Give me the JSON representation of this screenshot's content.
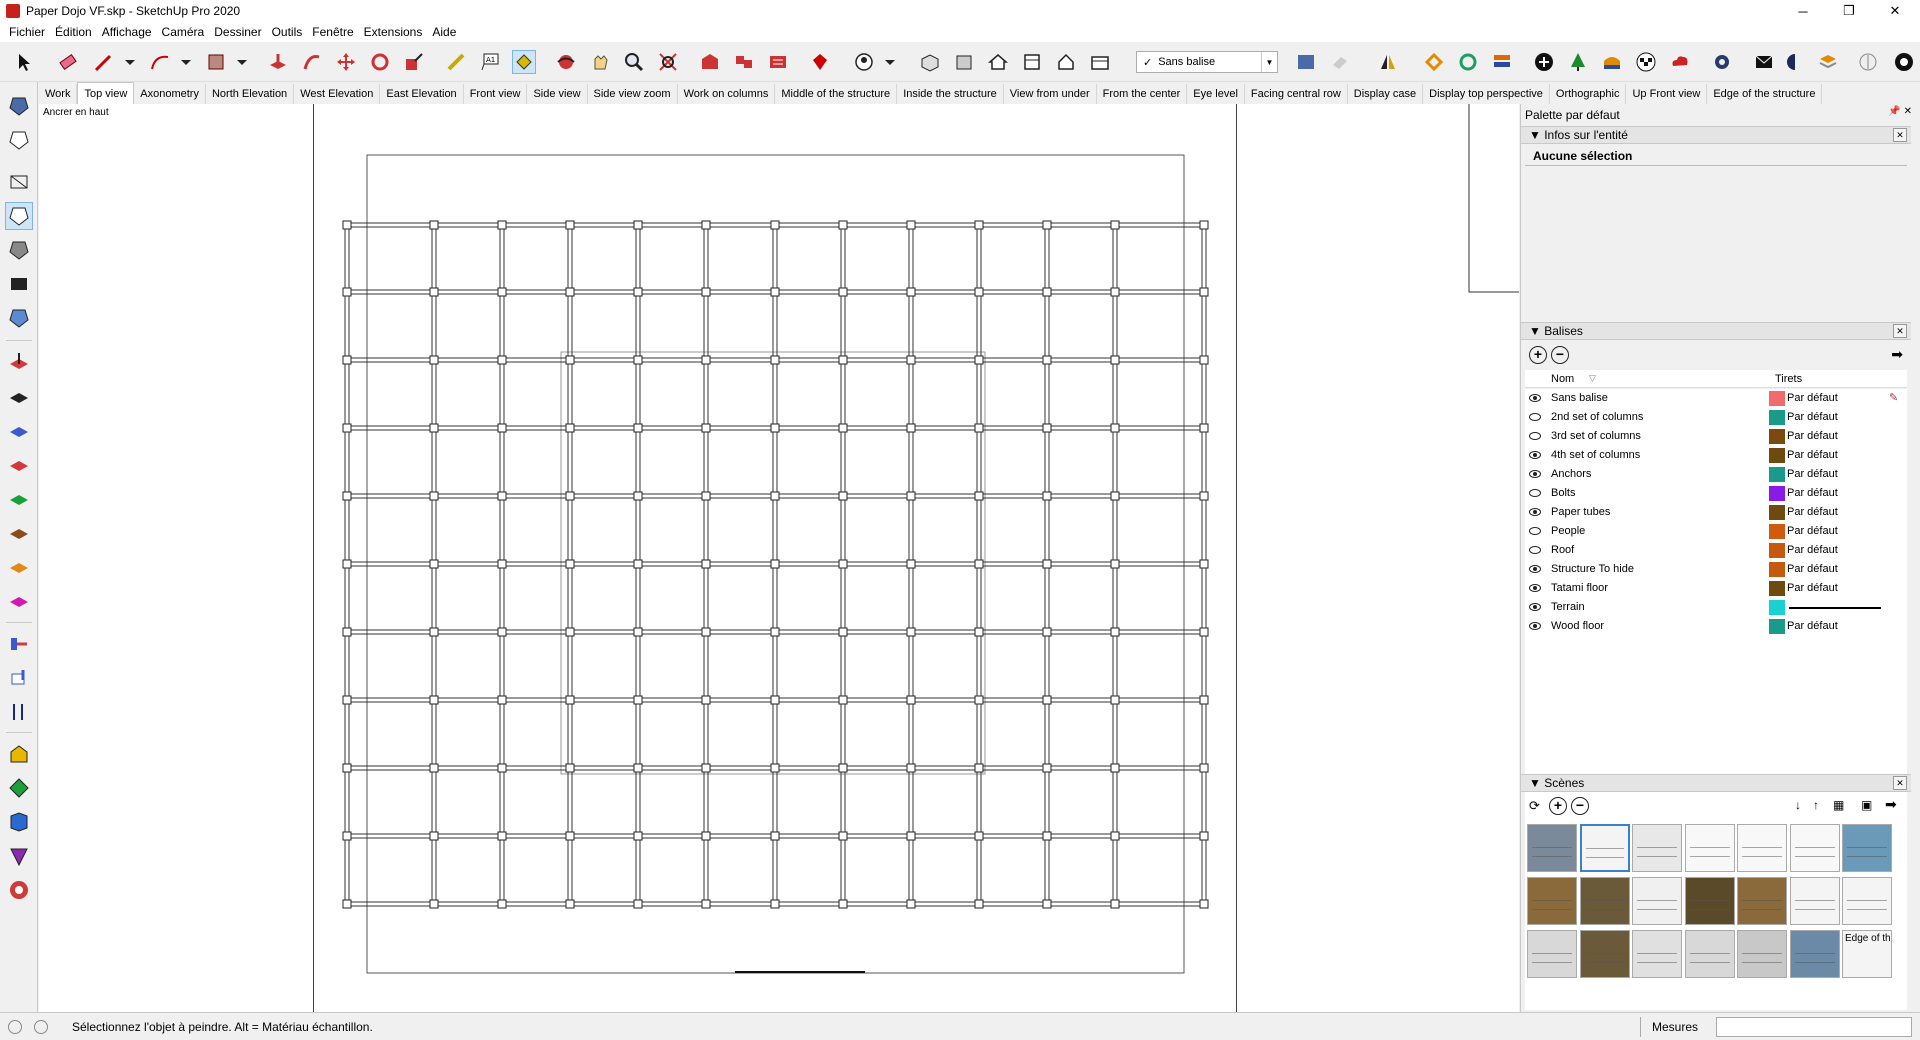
{
  "window": {
    "title": "Paper Dojo VF.skp - SketchUp Pro 2020",
    "min": "─",
    "max": "❐",
    "close": "✕"
  },
  "menu": [
    "Fichier",
    "Édition",
    "Affichage",
    "Caméra",
    "Dessiner",
    "Outils",
    "Fenêtre",
    "Extensions",
    "Aide"
  ],
  "toolbar": {
    "tag_selected": "Sans balise",
    "tag_check": "✓"
  },
  "scene_tabs": [
    "Work",
    "Top view",
    "Axonometry",
    "North Elevation",
    "West Elevation",
    "East Elevation",
    "Front view",
    "Side view",
    "Side view zoom",
    "Work on columns",
    "Middle of the structure",
    "Inside the structure",
    "View from under",
    "From the center",
    "Eye level",
    "Facing central row",
    "Display case",
    "Display top perspective",
    "Orthographic",
    "Up Front view",
    "Edge of the structure"
  ],
  "active_scene_tab": 1,
  "viewport": {
    "anchor_label": "Ancrer en haut"
  },
  "tray": {
    "title": "Palette par défaut",
    "entity_panel": {
      "title": "Infos sur l'entité",
      "content": "Aucune sélection"
    },
    "tags_panel": {
      "title": "Balises",
      "col_name": "Nom",
      "col_dashes": "Tirets",
      "rows": [
        {
          "name": "Sans balise",
          "visible": true,
          "color": "#f26b6b",
          "dashes": "Par défaut"
        },
        {
          "name": "2nd set of columns",
          "visible": false,
          "color": "#1a9a8a",
          "dashes": "Par défaut"
        },
        {
          "name": "3rd set of columns",
          "visible": false,
          "color": "#7a4a10",
          "dashes": "Par défaut"
        },
        {
          "name": "4th set of columns",
          "visible": true,
          "color": "#6e4a10",
          "dashes": "Par défaut"
        },
        {
          "name": "Anchors",
          "visible": true,
          "color": "#1a9a8a",
          "dashes": "Par défaut"
        },
        {
          "name": "Bolts",
          "visible": false,
          "color": "#8a1ae6",
          "dashes": "Par défaut"
        },
        {
          "name": "Paper tubes",
          "visible": true,
          "color": "#6e4a10",
          "dashes": "Par défaut"
        },
        {
          "name": "People",
          "visible": false,
          "color": "#d05a10",
          "dashes": "Par défaut"
        },
        {
          "name": "Roof",
          "visible": false,
          "color": "#c45a10",
          "dashes": "Par défaut"
        },
        {
          "name": "Structure To hide",
          "visible": true,
          "color": "#c45a10",
          "dashes": "Par défaut"
        },
        {
          "name": "Tatami floor",
          "visible": true,
          "color": "#6e4a10",
          "dashes": "Par défaut"
        },
        {
          "name": "Terrain",
          "visible": true,
          "color": "#1ad0d0",
          "dashes": ""
        },
        {
          "name": "Wood floor",
          "visible": true,
          "color": "#1a9a8a",
          "dashes": "Par défaut"
        }
      ]
    },
    "scenes_panel": {
      "title": "Scènes",
      "last_thumb_label": "Edge of th"
    }
  },
  "status": {
    "message": "Sélectionnez l'objet à peindre. Alt = Matériau échantillon.",
    "measures_label": "Mesures"
  }
}
